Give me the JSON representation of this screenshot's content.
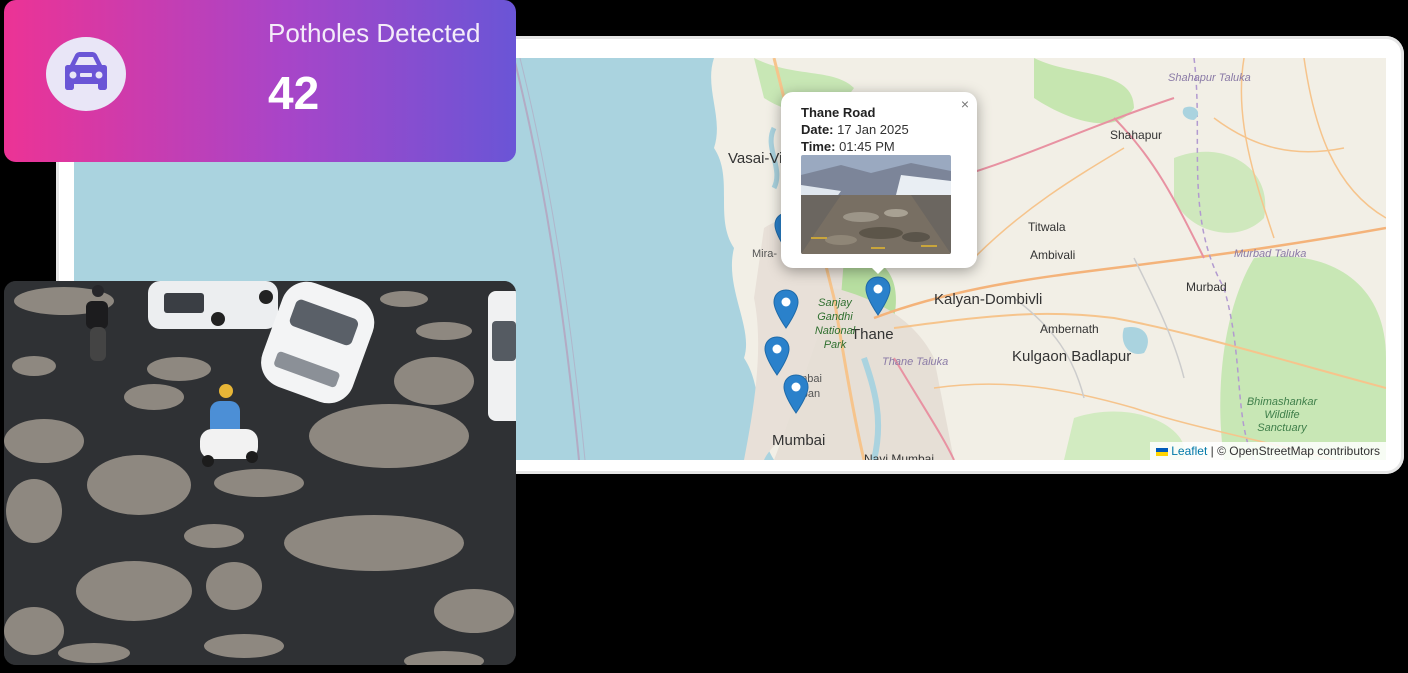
{
  "stats": {
    "label": "Potholes Detected",
    "value": "42",
    "icon": "car-icon",
    "gradient": [
      "#ec3395",
      "#6a55d6"
    ]
  },
  "map": {
    "places": {
      "vasai": "Vasai-Vi",
      "mira": "Mira-",
      "shahapur": "Shahapur",
      "shahapur_taluka": "Shahapur Taluka",
      "titwala": "Titwala",
      "ambivali": "Ambivali",
      "kalyan": "Kalyan-Dombivli",
      "murbad": "Murbad",
      "murbad_taluka": "Murbad Taluka",
      "ambernath": "Ambernath",
      "kulgaon": "Kulgaon Badlapur",
      "thane": "Thane",
      "thane_taluka": "Thane Taluka",
      "sanjay": "Sanjay Gandhi National Park",
      "mumbai_suburban": "umbai urban",
      "mumbai": "Mumbai",
      "navi": "Navi Mumbai",
      "bhimashankar": "Bhimashankar Wildlife Sanctuary"
    },
    "popup": {
      "title": "Thane Road",
      "date_label": "Date:",
      "date": "17 Jan 2025",
      "time_label": "Time:",
      "time": "01:45 PM",
      "close": "×"
    },
    "attribution": {
      "leaflet": "Leaflet",
      "rest": "| © OpenStreetMap contributors"
    },
    "marker_color": "#2a81cb"
  }
}
